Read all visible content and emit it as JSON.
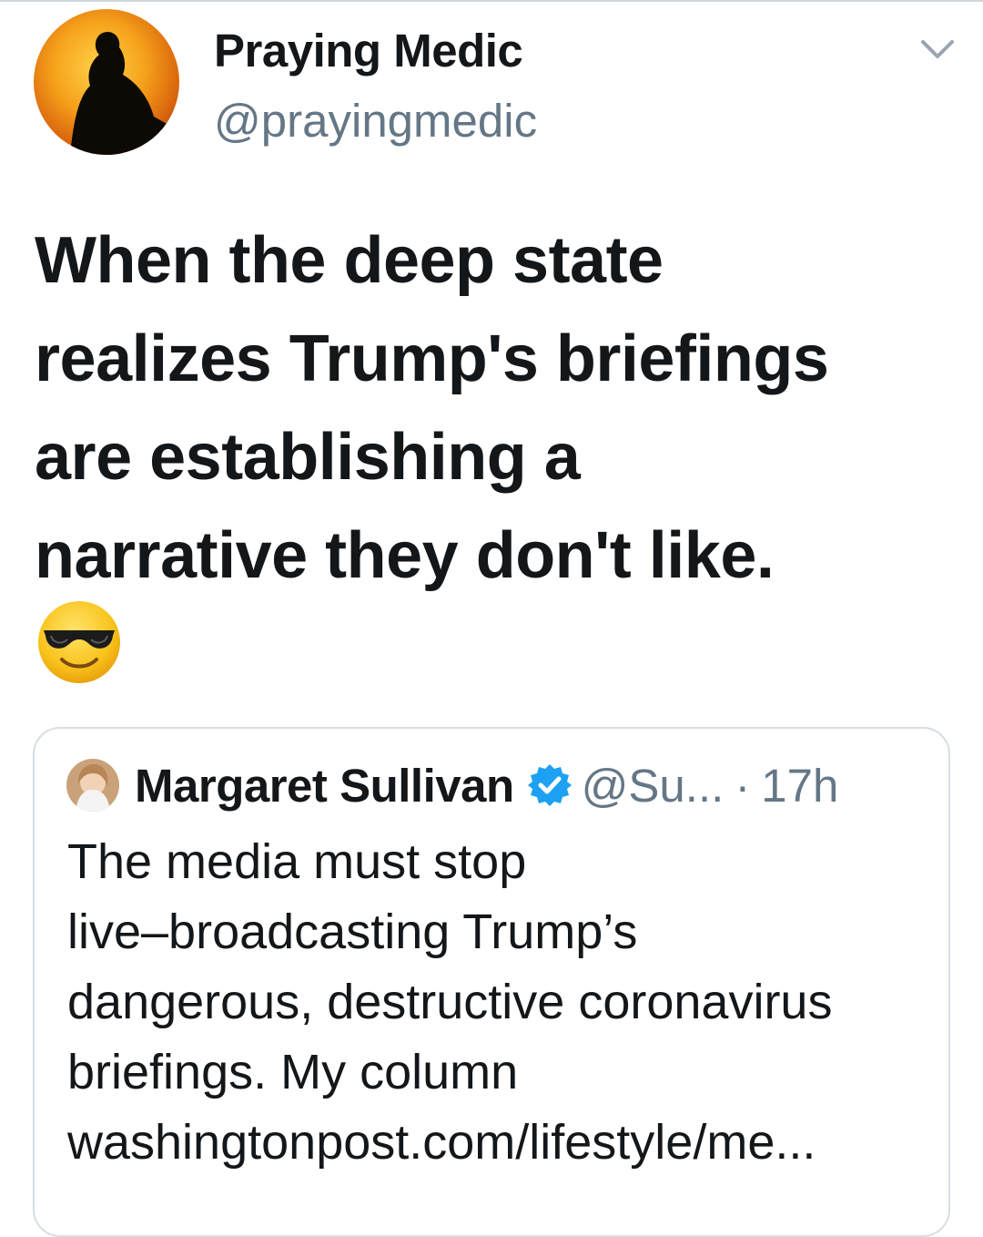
{
  "author": {
    "name": "Praying Medic",
    "handle": "@prayingmedic"
  },
  "tweet": {
    "lines": [
      "When the deep state",
      "realizes Trump's briefings",
      "are establishing a",
      "narrative they don't like."
    ],
    "emoji": "smiling-face-with-sunglasses"
  },
  "quoted_tweet": {
    "author_name": "Margaret Sullivan",
    "handle": "@Su...",
    "separator": "·",
    "time": "17h",
    "lines": [
      "The media must stop",
      "live–broadcasting Trump’s",
      "dangerous, destructive coronavirus",
      "briefings. My column",
      "washingtonpost.com/lifestyle/me..."
    ]
  },
  "colors": {
    "text": "#14171a",
    "secondary": "#657786",
    "verified": "#1da1f2",
    "border": "#d8dee4"
  }
}
